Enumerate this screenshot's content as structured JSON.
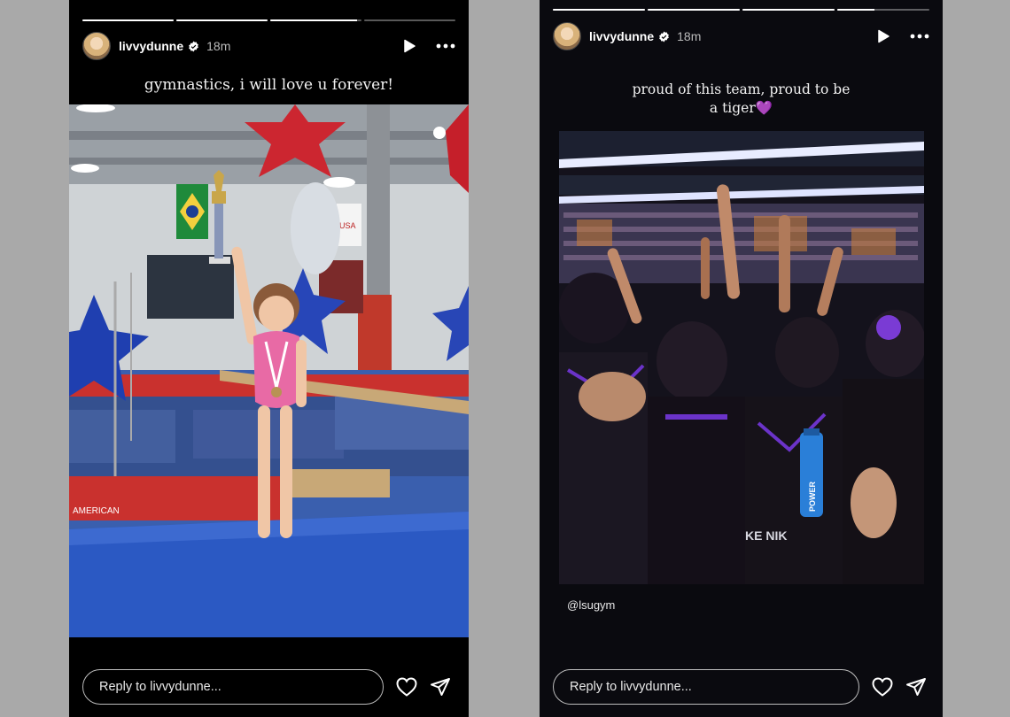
{
  "stories": [
    {
      "username": "livvydunne",
      "time": "18m",
      "caption": "gymnastics, i will love u forever!",
      "progress": [
        1,
        1,
        0.95,
        0
      ],
      "reply_placeholder": "Reply to livvydunne...",
      "photo_labels": {
        "brand": "AMERICAN",
        "flag_text": "USA"
      }
    },
    {
      "username": "livvydunne",
      "time": "18m",
      "caption": "proud of this team, proud to be a tiger💜",
      "progress": [
        1,
        1,
        1,
        0.4
      ],
      "mention": "@lsugym",
      "reply_placeholder": "Reply to livvydunne...",
      "photo_labels": {
        "bottle": "POWER",
        "jersey": "KE NIK"
      }
    }
  ],
  "icons": {
    "verified": "verified-badge-icon",
    "play": "play-icon",
    "more": "more-options-icon",
    "like": "heart-icon",
    "share": "send-icon"
  },
  "colors": {
    "verified": "#ffffff",
    "lsu_purple": "#5b2a86"
  }
}
